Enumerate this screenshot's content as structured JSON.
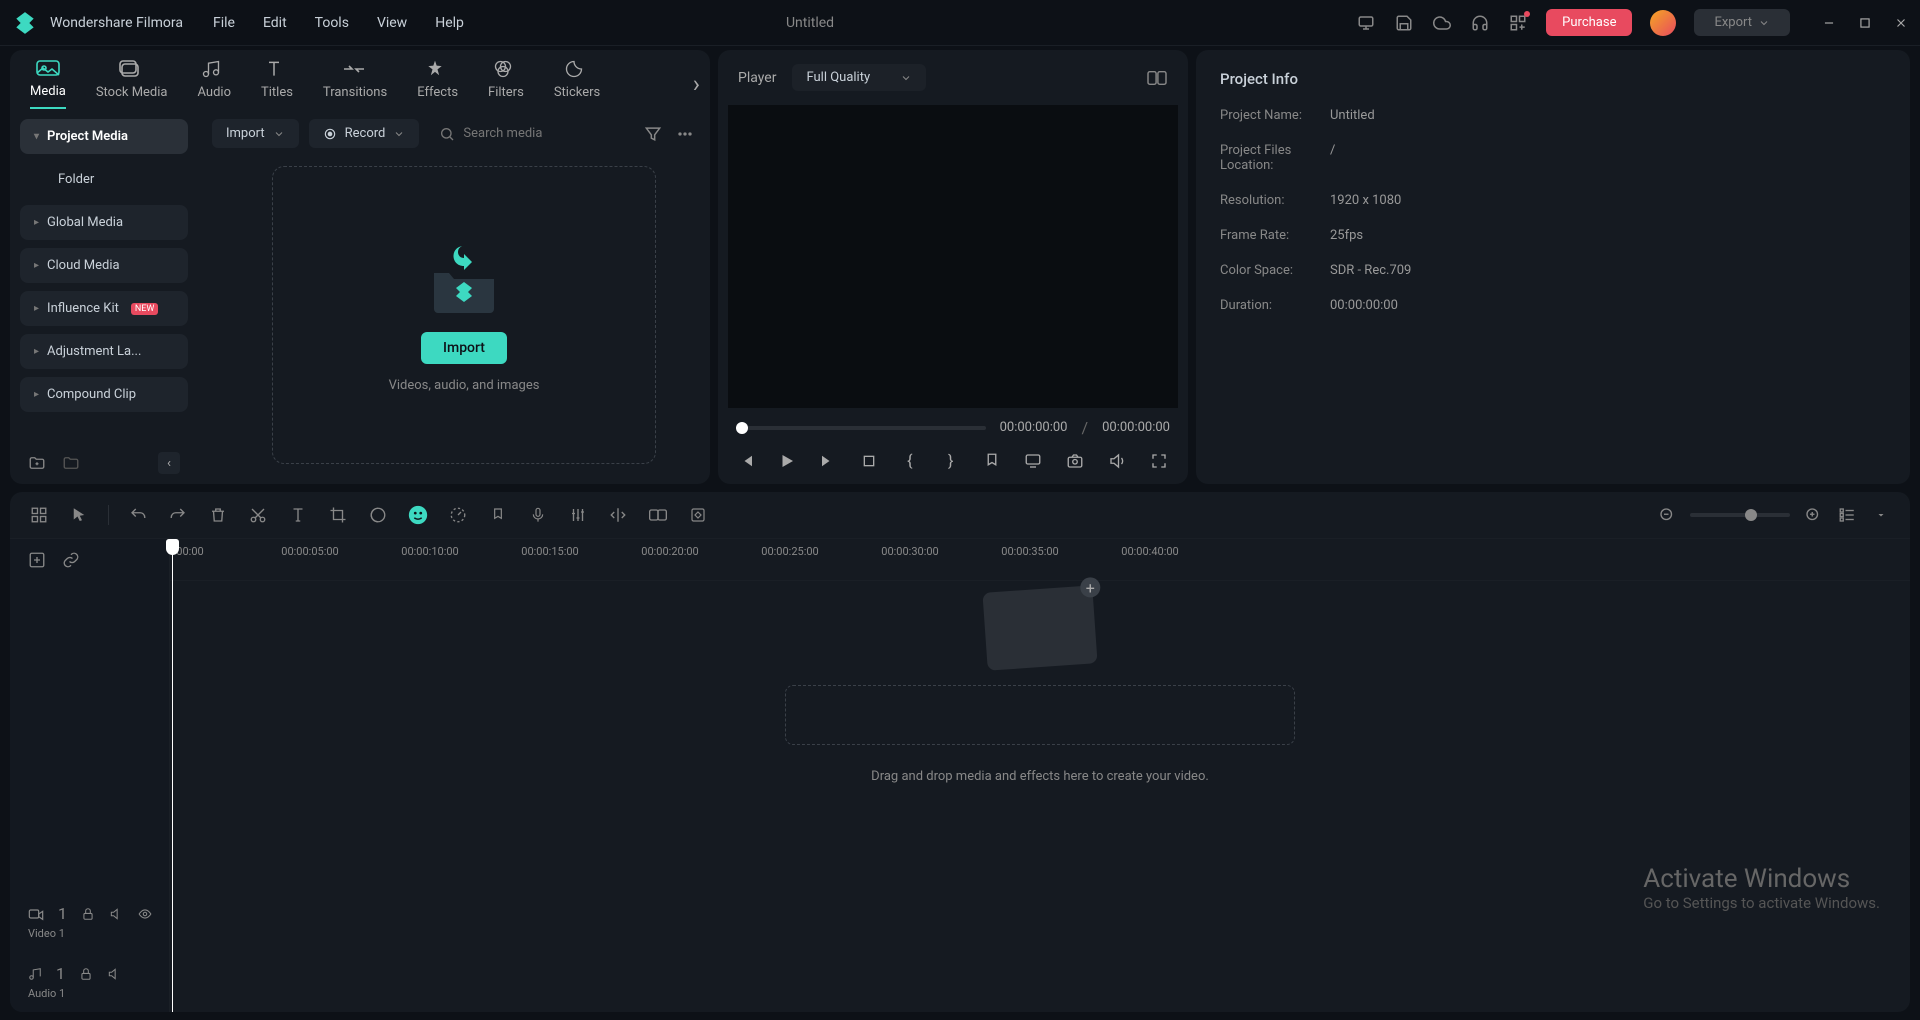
{
  "app": {
    "title": "Wondershare Filmora",
    "document": "Untitled"
  },
  "menu": [
    "File",
    "Edit",
    "Tools",
    "View",
    "Help"
  ],
  "titlebar": {
    "purchase": "Purchase",
    "export": "Export"
  },
  "topTabs": [
    "Media",
    "Stock Media",
    "Audio",
    "Titles",
    "Transitions",
    "Effects",
    "Filters",
    "Stickers"
  ],
  "sidebar": {
    "items": [
      {
        "label": "Project Media",
        "active": true
      },
      {
        "label": "Folder",
        "sub": true
      },
      {
        "label": "Global Media"
      },
      {
        "label": "Cloud Media"
      },
      {
        "label": "Influence Kit",
        "badge": "NEW"
      },
      {
        "label": "Adjustment La..."
      },
      {
        "label": "Compound Clip"
      }
    ]
  },
  "mediaToolbar": {
    "import": "Import",
    "record": "Record",
    "searchPlaceholder": "Search media"
  },
  "dropzone": {
    "button": "Import",
    "text": "Videos, audio, and images"
  },
  "player": {
    "label": "Player",
    "quality": "Full Quality",
    "current": "00:00:00:00",
    "total": "00:00:00:00"
  },
  "projectInfo": {
    "header": "Project Info",
    "rows": [
      {
        "key": "Project Name:",
        "val": "Untitled"
      },
      {
        "key": "Project Files Location:",
        "val": "/"
      },
      {
        "key": "Resolution:",
        "val": "1920 x 1080"
      },
      {
        "key": "Frame Rate:",
        "val": "25fps"
      },
      {
        "key": "Color Space:",
        "val": "SDR - Rec.709"
      },
      {
        "key": "Duration:",
        "val": "00:00:00:00"
      }
    ]
  },
  "ruler": [
    "00:00",
    "00:00:05:00",
    "00:00:10:00",
    "00:00:15:00",
    "00:00:20:00",
    "00:00:25:00",
    "00:00:30:00",
    "00:00:35:00",
    "00:00:40:00"
  ],
  "tracks": {
    "video": {
      "num": "1",
      "label": "Video 1"
    },
    "audio": {
      "num": "1",
      "label": "Audio 1"
    }
  },
  "timelineHint": "Drag and drop media and effects here to create your video.",
  "watermark": {
    "title": "Activate Windows",
    "sub": "Go to Settings to activate Windows."
  }
}
